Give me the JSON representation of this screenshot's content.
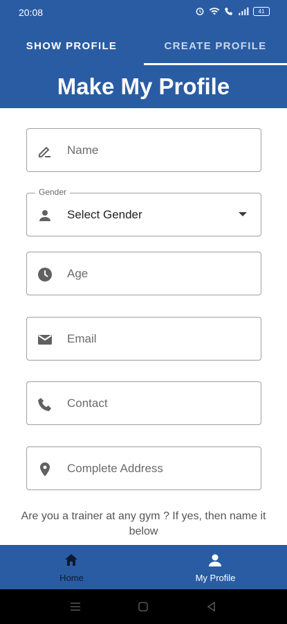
{
  "status_bar": {
    "time": "20:08",
    "battery": "41"
  },
  "tabs": [
    {
      "label": "SHOW PROFILE",
      "selected": false
    },
    {
      "label": "CREATE PROFILE",
      "selected": true
    }
  ],
  "header": {
    "title": "Make My Profile"
  },
  "form": {
    "name": {
      "placeholder": "Name",
      "icon": "edit-icon"
    },
    "gender": {
      "label": "Gender",
      "value": "Select Gender",
      "icon": "person-icon"
    },
    "age": {
      "placeholder": "Age",
      "icon": "clock-icon"
    },
    "email": {
      "placeholder": "Email",
      "icon": "mail-icon"
    },
    "contact": {
      "placeholder": "Contact",
      "icon": "phone-icon"
    },
    "address": {
      "placeholder": "Complete Address",
      "icon": "location-icon"
    },
    "trainer_question": "Are you a trainer at any gym ? If yes, then name it below"
  },
  "bottom_nav": [
    {
      "label": "Home",
      "icon": "home-icon",
      "selected": false
    },
    {
      "label": "My Profile",
      "icon": "person-icon",
      "selected": true
    }
  ],
  "colors": {
    "primary": "#2a5ca4",
    "field_border": "#9e9e9e",
    "icon": "#616161"
  }
}
